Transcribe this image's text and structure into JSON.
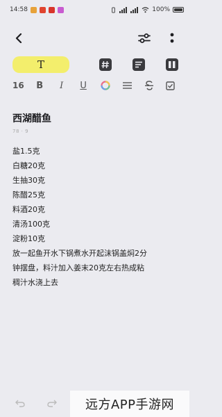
{
  "status_bar": {
    "time": "14:58",
    "battery": "100%"
  },
  "toolbar": {
    "text_style": "T",
    "font_size": "16",
    "bold": "B",
    "italic": "I",
    "underline": "U"
  },
  "note": {
    "title": "西湖醋鱼",
    "timestamp": "78 · 9",
    "lines": [
      "盐1.5克",
      "白糖20克",
      "生抽30克",
      "陈醋25克",
      "料酒20克",
      "清汤100克",
      "淀粉10克",
      "放一起鱼开水下锅煮水开起沫锅盖焖2分",
      "钟摆盘，料汁加入姜末20克左右热成粘",
      "稠汁水浇上去"
    ]
  },
  "watermark": "远方APP手游网",
  "colors": {
    "background": "#ebebf0",
    "highlight": "#f3ee6c"
  }
}
